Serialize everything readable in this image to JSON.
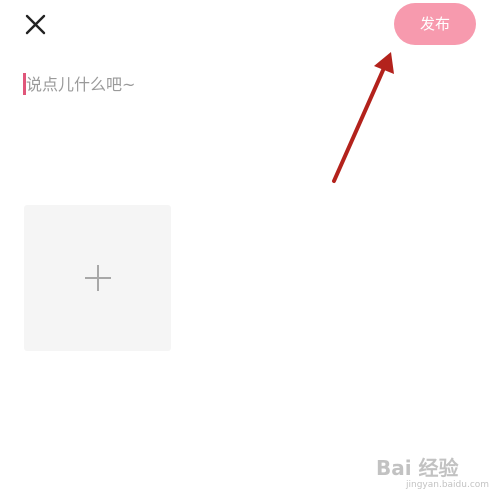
{
  "header": {
    "close_icon": "close-icon",
    "publish_label": "发布"
  },
  "composer": {
    "placeholder": "说点儿什么吧~"
  },
  "media": {
    "add_icon": "plus-icon"
  },
  "colors": {
    "publish_bg": "#f79aae",
    "caret": "#e0567a",
    "arrow": "#b3221c",
    "tile_bg": "#f5f5f5"
  },
  "watermark": {
    "logo_text": "Bai  经验",
    "sub_text": "jingyan.baidu.com"
  }
}
